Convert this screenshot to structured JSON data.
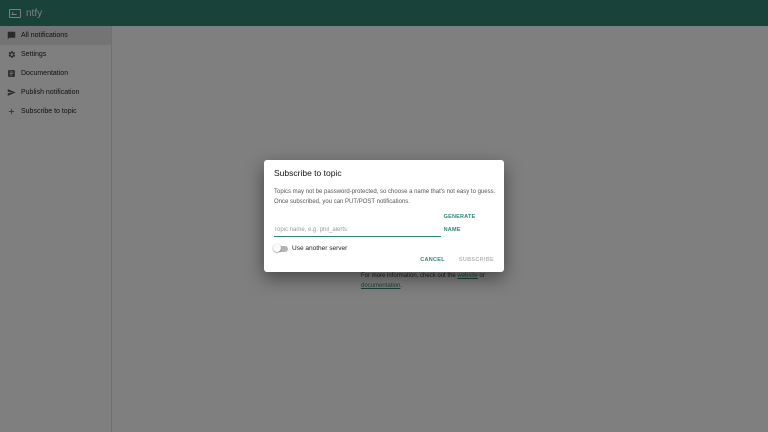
{
  "app": {
    "title": "ntfy"
  },
  "sidebar": {
    "items": [
      {
        "label": "All notifications",
        "icon": "chat-bubble-icon"
      },
      {
        "label": "Settings",
        "icon": "gear-icon"
      },
      {
        "label": "Documentation",
        "icon": "document-icon"
      },
      {
        "label": "Publish notification",
        "icon": "send-icon"
      },
      {
        "label": "Subscribe to topic",
        "icon": "plus-icon"
      }
    ]
  },
  "main": {
    "hint_text": "For more information, check out the",
    "hint_link1": "website",
    "hint_or": "or",
    "hint_link2": "documentation"
  },
  "dialog": {
    "title": "Subscribe to topic",
    "description": "Topics may not be password-protected, so choose a name that's not easy to guess. Once subscribed, you can PUT/POST notifications.",
    "topic_placeholder": "Topic name, e.g. phil_alerts",
    "topic_value": "",
    "generate_label": "GENERATE NAME",
    "switch_label": "Use another server",
    "switch_on": false,
    "cancel_label": "CANCEL",
    "subscribe_label": "SUBSCRIBE"
  },
  "colors": {
    "accent": "#338574",
    "appbar": "#338574"
  }
}
